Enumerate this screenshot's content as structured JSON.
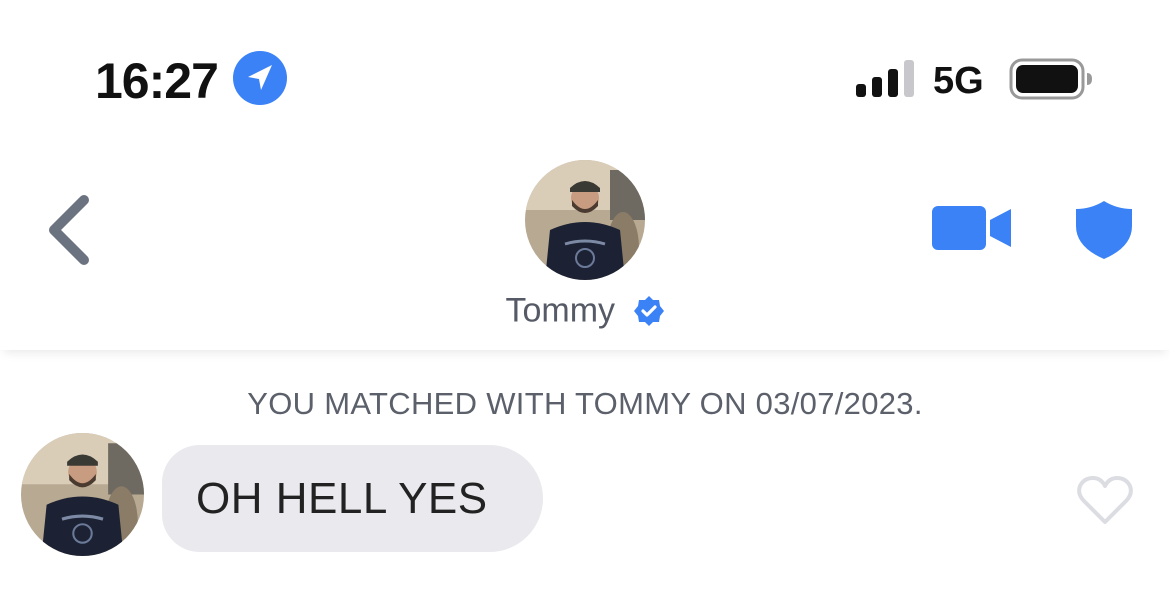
{
  "status_bar": {
    "time": "16:27",
    "network": "5G",
    "icons": [
      "location-arrow-icon",
      "signal-bars-icon",
      "battery-icon"
    ]
  },
  "header": {
    "name": "Tommy",
    "icons": [
      "chevron-left-icon",
      "verified-badge-icon",
      "video-camera-icon",
      "shield-icon"
    ],
    "accent_color": "#3b82f6"
  },
  "chat": {
    "match_banner": "YOU MATCHED WITH TOMMY ON 03/07/2023.",
    "messages": [
      {
        "sender": "Tommy",
        "text": "OH HELL YES",
        "liked": false
      }
    ]
  },
  "colors": {
    "accent": "#3b82f6",
    "bubble_bg": "#e9e9ee",
    "icon_gray": "#6b7280",
    "heart_outline": "#dcdde2"
  }
}
